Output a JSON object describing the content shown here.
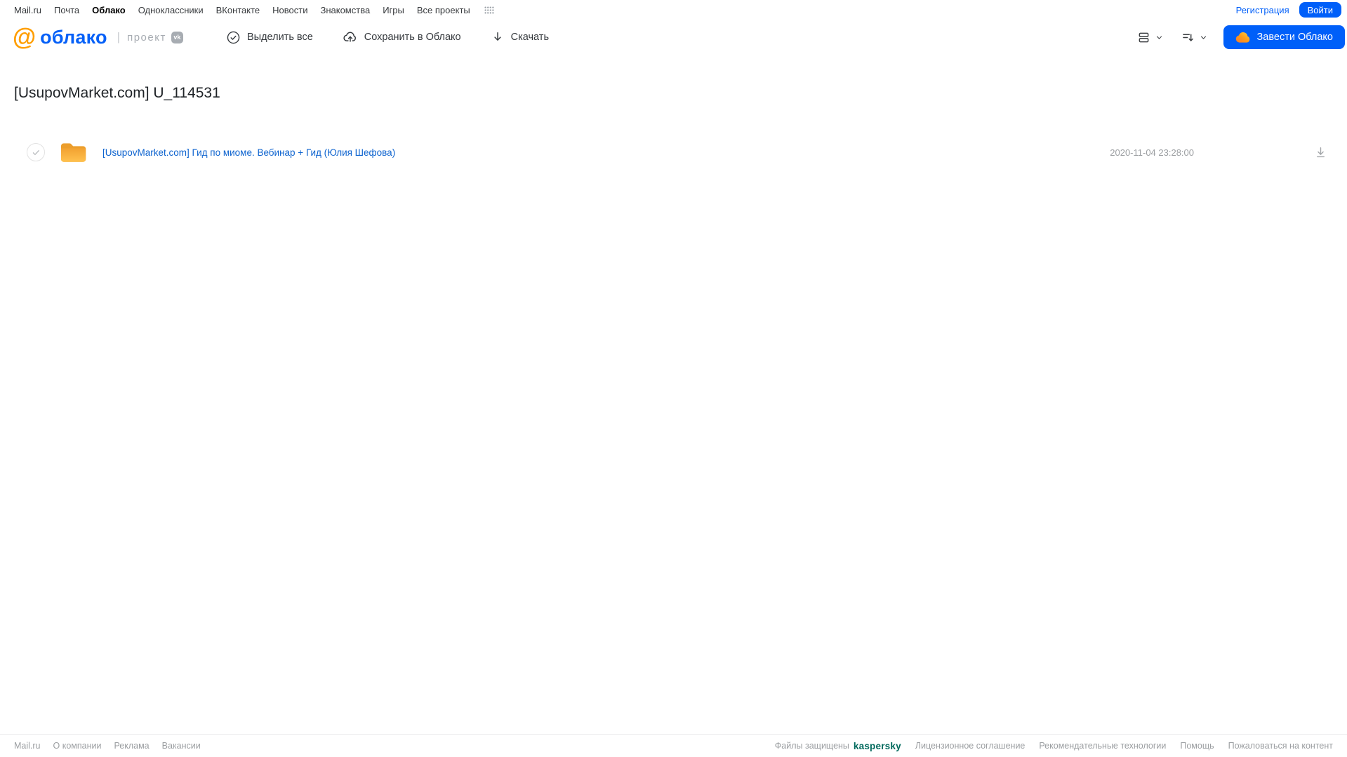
{
  "topnav": {
    "links": [
      {
        "label": "Mail.ru"
      },
      {
        "label": "Почта"
      },
      {
        "label": "Облако"
      },
      {
        "label": "Одноклассники"
      },
      {
        "label": "ВКонтакте"
      },
      {
        "label": "Новости"
      },
      {
        "label": "Знакомства"
      },
      {
        "label": "Игры"
      },
      {
        "label": "Все проекты"
      }
    ],
    "active_link": "Облако",
    "registration_label": "Регистрация",
    "login_label": "Войти"
  },
  "header": {
    "logo_at": "@",
    "logo_text": "облако",
    "logo_divider": "|",
    "project_label": "проект",
    "vk_badge_text": "vk",
    "select_all_label": "Выделить все",
    "save_to_cloud_label": "Сохранить в Облако",
    "download_label": "Скачать",
    "create_cloud_label": "Завести Облако"
  },
  "main": {
    "title": "[UsupovMarket.com] U_114531",
    "files": [
      {
        "type": "folder",
        "name": "[UsupovMarket.com] Гид по миоме. Вебинар + Гид (Юлия Шефова)",
        "date": "2020-11-04 23:28:00"
      }
    ]
  },
  "footer": {
    "links_left": [
      {
        "label": "Mail.ru"
      },
      {
        "label": "О компании"
      },
      {
        "label": "Реклама"
      },
      {
        "label": "Вакансии"
      }
    ],
    "protected_label": "Файлы защищены",
    "kaspersky_label": "kaspersky",
    "links_right": [
      {
        "label": "Лицензионное соглашение"
      },
      {
        "label": "Рекомендательные технологии"
      },
      {
        "label": "Помощь"
      },
      {
        "label": "Пожаловаться на контент"
      }
    ]
  },
  "colors": {
    "accent_blue": "#005FF9",
    "logo_orange": "#FF9E00",
    "folder_top": "#F2A231",
    "folder_bottom": "#FFC14E",
    "kaspersky_teal": "#00695C",
    "muted_gray": "#9b9ea1",
    "link_blue": "#0d63cf"
  },
  "icons": {
    "at-logo-icon": "orange @ glyph",
    "grid-dots-icon": "4x3 dot grid",
    "check-circle-icon": "circle with checkmark",
    "cloud-upload-icon": "cloud with up arrow",
    "download-icon": "down arrow",
    "view-toggle-icon": "two stacked rounded rows",
    "sort-icon": "lines with down arrow",
    "chevron-down-icon": "chevron down",
    "cloud-icon": "orange cloud",
    "folder-icon": "yellow folder",
    "vk-icon": "vk badge",
    "checkbox-icon": "gray check in circle",
    "row-download-icon": "down arrow with underline"
  }
}
